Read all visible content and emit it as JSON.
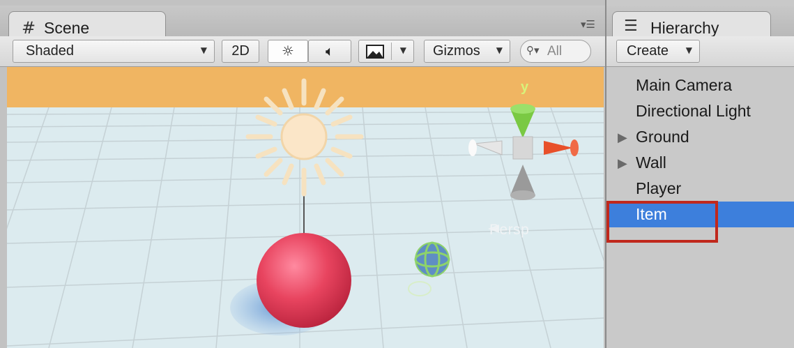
{
  "scene": {
    "tab": {
      "label": "Scene",
      "icon": "grid-icon"
    },
    "toolbar": {
      "shading_mode": "Shaded",
      "mode_2d_label": "2D",
      "gizmos_label": "Gizmos",
      "search_placeholder": "All"
    },
    "viewport": {
      "persp_label": "Persp",
      "axis_y_label": "y"
    }
  },
  "hierarchy": {
    "tab": {
      "label": "Hierarchy",
      "icon": "list-icon"
    },
    "create_label": "Create",
    "items": [
      {
        "label": "Main Camera",
        "expandable": false,
        "selected": false
      },
      {
        "label": "Directional Light",
        "expandable": false,
        "selected": false
      },
      {
        "label": "Ground",
        "expandable": true,
        "selected": false
      },
      {
        "label": "Wall",
        "expandable": true,
        "selected": false
      },
      {
        "label": "Player",
        "expandable": false,
        "selected": false
      },
      {
        "label": "Item",
        "expandable": false,
        "selected": true
      }
    ]
  },
  "colors": {
    "selection": "#3d7fdc",
    "highlight_box": "#c0281c",
    "wall": "#f0b562",
    "ground": "#dcebef",
    "player_sphere": "#e8445f",
    "axis_y": "#7ac943",
    "axis_x": "#e8502a"
  }
}
